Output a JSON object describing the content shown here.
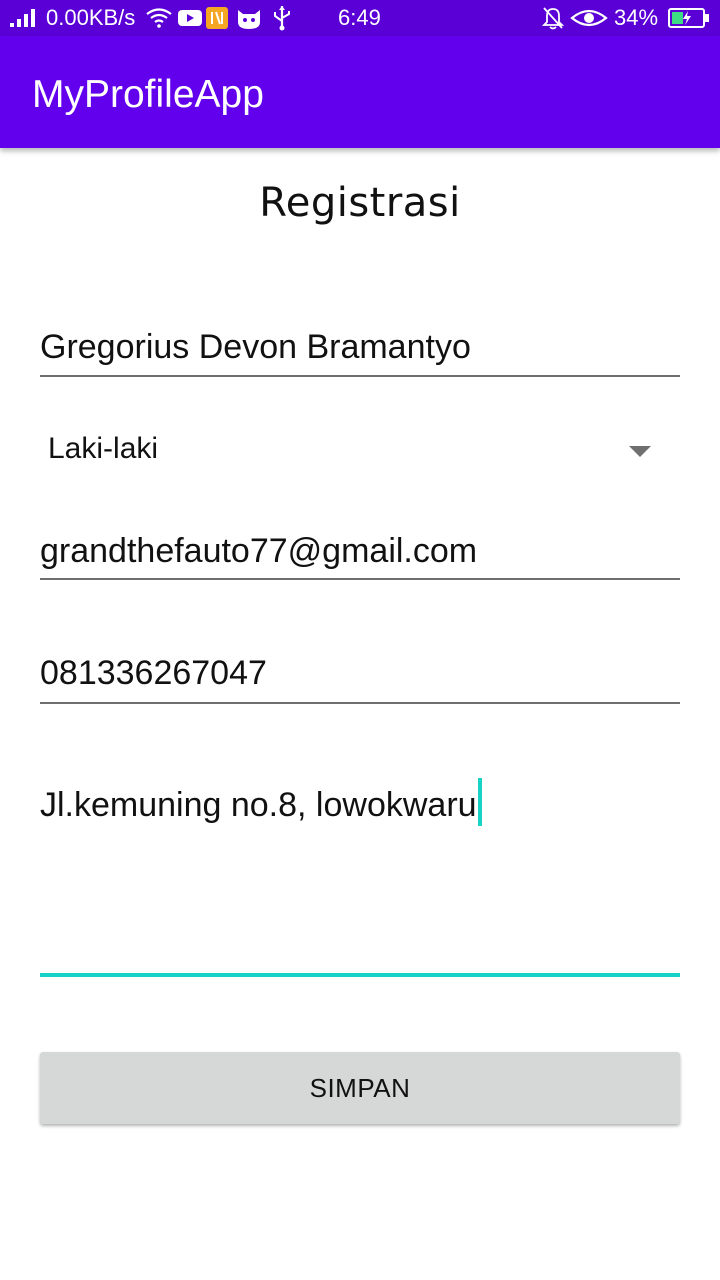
{
  "status_bar": {
    "net_speed": "0.00KB/s",
    "time": "6:49",
    "battery_percent": "34%",
    "battery_level": 0.34,
    "icons": [
      "signal-icon",
      "wifi-icon",
      "youtube-icon",
      "app-notification-icon",
      "cat-icon",
      "usb-icon",
      "bell-off-icon",
      "eye-icon",
      "battery-charging-icon"
    ],
    "background": "#5a00d6"
  },
  "app_bar": {
    "title": "MyProfileApp",
    "background": "#6200ee"
  },
  "form": {
    "title": "Registrasi",
    "name_value": "Gregorius Devon Bramantyo",
    "gender_selected": "Laki-laki",
    "email_value": "grandthefauto77@gmail.com",
    "phone_value": "081336267047",
    "address_value": "Jl.kemuning no.8, lowokwaru",
    "focus_color": "#16d3c6",
    "save_label": "SIMPAN"
  }
}
